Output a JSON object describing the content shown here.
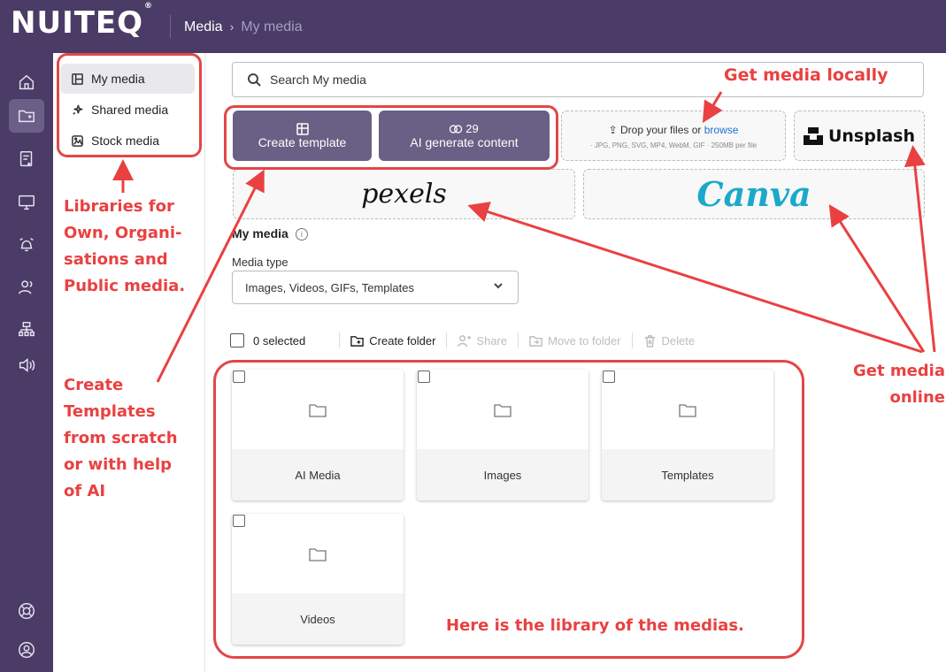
{
  "app": {
    "logo": "NUITEQ",
    "registered": "®"
  },
  "breadcrumb": {
    "root": "Media",
    "separator": "›",
    "current": "My media"
  },
  "rail": {
    "icons": [
      "home-icon",
      "media-icon",
      "notes-icon",
      "screen-icon",
      "bell-icon",
      "users-icon",
      "org-icon",
      "broadcast-icon",
      "help-icon",
      "account-icon"
    ]
  },
  "libraries": {
    "items": [
      {
        "label": "My media",
        "icon": "layout-icon"
      },
      {
        "label": "Shared media",
        "icon": "sparkle-icon"
      },
      {
        "label": "Stock media",
        "icon": "image-icon"
      }
    ]
  },
  "search": {
    "placeholder": "Search My media"
  },
  "actions": {
    "create_template": "Create template",
    "ai_count": "29",
    "ai_generate": "AI generate content",
    "drop_text": "Drop your files or",
    "drop_link": "browse",
    "drop_formats": "· JPG, PNG, SVG, MP4, WebM, GIF · 250MB per file",
    "unsplash": "Unsplash",
    "pexels": "pexels",
    "canva": "Canva"
  },
  "section": {
    "title": "My media",
    "info": "i"
  },
  "filter": {
    "label": "Media type",
    "value": "Images, Videos, GIFs, Templates"
  },
  "toolbar": {
    "selected": "0 selected",
    "create_folder": "Create folder",
    "share": "Share",
    "move": "Move to folder",
    "delete": "Delete"
  },
  "folders": [
    "AI Media",
    "Images",
    "Templates",
    "Videos"
  ],
  "annotations": {
    "get_local": "Get media locally",
    "libraries": [
      "Libraries for",
      "Own, Organi-",
      "sations and",
      "Public media."
    ],
    "templates": [
      "Create",
      "Templates",
      "from scratch",
      "or with help",
      "of AI"
    ],
    "get_online": [
      "Get media",
      "online"
    ],
    "library_note": "Here is the library of the medias."
  },
  "colors": {
    "brand": "#4a3c66",
    "button": "#6a5f85",
    "annotation": "#e94141",
    "link": "#1f6fd6",
    "canva": "#1aa9c9"
  }
}
